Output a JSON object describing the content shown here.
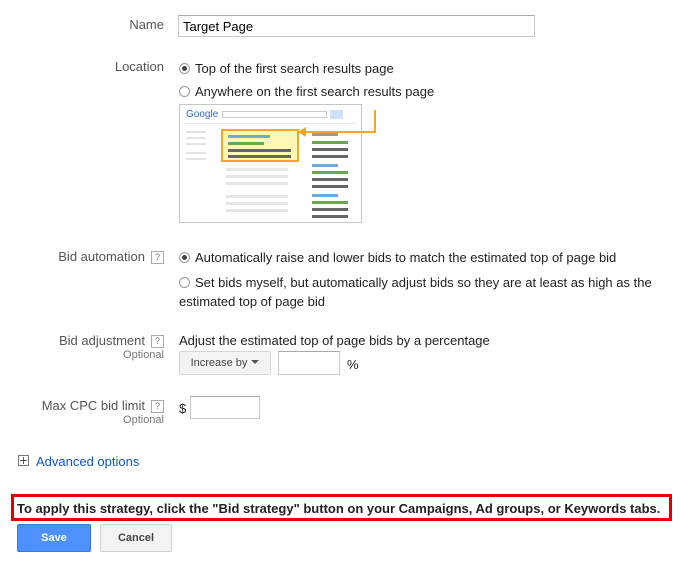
{
  "name": {
    "label": "Name",
    "value": "Target Page"
  },
  "location": {
    "label": "Location",
    "options": [
      {
        "label": "Top of the first search results page",
        "selected": true
      },
      {
        "label": "Anywhere on the first search results page",
        "selected": false
      }
    ],
    "illustration": {
      "logo": "Google"
    }
  },
  "bid_automation": {
    "label": "Bid automation",
    "help": "?",
    "options": [
      {
        "label": "Automatically raise and lower bids to match the estimated top of page bid",
        "selected": true
      },
      {
        "label_line1": "Set bids myself, but automatically adjust bids so they are at least as high as the",
        "label_line2": "estimated top of page bid",
        "selected": false
      }
    ]
  },
  "bid_adjustment": {
    "label": "Bid adjustment",
    "help": "?",
    "optional": "Optional",
    "description": "Adjust the estimated top of page bids by a percentage",
    "dropdown_label": "Increase by",
    "value": "",
    "unit": "%"
  },
  "max_cpc": {
    "label": "Max CPC bid limit",
    "help": "?",
    "optional": "Optional",
    "currency": "$",
    "value": ""
  },
  "advanced": {
    "label": "Advanced options"
  },
  "notice": "To apply this strategy, click the \"Bid strategy\" button on your Campaigns, Ad groups, or Keywords tabs.",
  "buttons": {
    "save": "Save",
    "cancel": "Cancel"
  },
  "colors": {
    "accent_blue": "#4d90fe",
    "link": "#1155cc",
    "notice_border": "#e00000",
    "highlight_orange": "#f5a623"
  }
}
